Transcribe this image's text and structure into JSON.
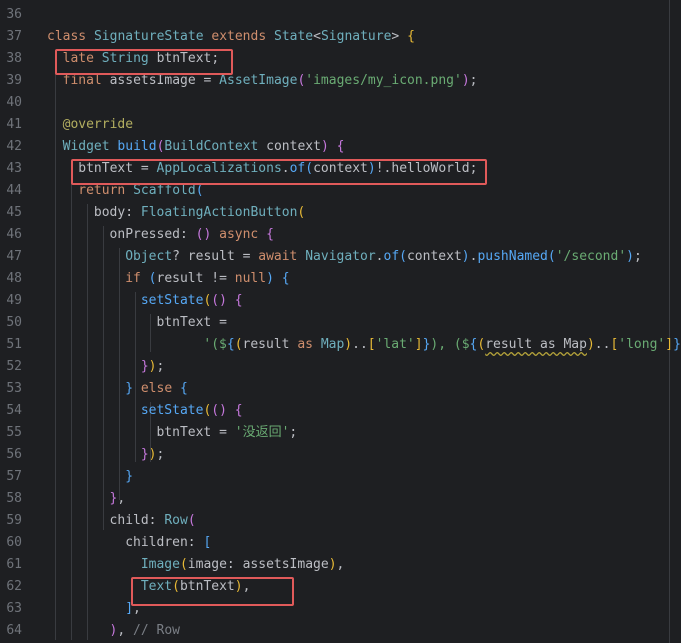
{
  "editor": {
    "lines": [
      {
        "n": "36",
        "segs": []
      },
      {
        "n": "37",
        "segs": [
          [
            "k",
            "class "
          ],
          [
            "cls",
            "SignatureState "
          ],
          [
            "k",
            "extends "
          ],
          [
            "cls",
            "State"
          ],
          [
            "t",
            "<"
          ],
          [
            "cls",
            "Signature"
          ],
          [
            "t",
            "> "
          ],
          [
            "b1",
            "{"
          ]
        ]
      },
      {
        "n": "38",
        "segs": [
          [
            "k",
            "late "
          ],
          [
            "cls",
            "String "
          ],
          [
            "t",
            "btnText;"
          ]
        ]
      },
      {
        "n": "39",
        "segs": [
          [
            "k",
            "final "
          ],
          [
            "t",
            "assetsImage = "
          ],
          [
            "cls",
            "AssetImage"
          ],
          [
            "b2",
            "("
          ],
          [
            "s",
            "'images/my_icon.png'"
          ],
          [
            "b2",
            ")"
          ],
          [
            "t",
            ";"
          ]
        ]
      },
      {
        "n": "40",
        "segs": []
      },
      {
        "n": "41",
        "segs": [
          [
            "a",
            "@override"
          ]
        ]
      },
      {
        "n": "42",
        "segs": [
          [
            "cls",
            "Widget "
          ],
          [
            "f",
            "build"
          ],
          [
            "b2",
            "("
          ],
          [
            "cls",
            "BuildContext "
          ],
          [
            "t",
            "context"
          ],
          [
            "b2",
            ")"
          ],
          [
            "t",
            " "
          ],
          [
            "b2",
            "{"
          ]
        ]
      },
      {
        "n": "43",
        "segs": [
          [
            "t",
            "btnText = "
          ],
          [
            "cls",
            "AppLocalizations"
          ],
          [
            "t",
            "."
          ],
          [
            "f",
            "of"
          ],
          [
            "b3",
            "("
          ],
          [
            "t",
            "context"
          ],
          [
            "b3",
            ")"
          ],
          [
            "t",
            "!.helloWorld;"
          ]
        ]
      },
      {
        "n": "44",
        "segs": [
          [
            "k",
            "return "
          ],
          [
            "cls",
            "Scaffold"
          ],
          [
            "b3",
            "("
          ]
        ]
      },
      {
        "n": "45",
        "segs": [
          [
            "t",
            "body: "
          ],
          [
            "cls",
            "FloatingActionButton"
          ],
          [
            "b1",
            "("
          ]
        ]
      },
      {
        "n": "46",
        "segs": [
          [
            "t",
            "onPressed: "
          ],
          [
            "b2",
            "()"
          ],
          [
            "t",
            " "
          ],
          [
            "k",
            "async "
          ],
          [
            "b2",
            "{"
          ]
        ]
      },
      {
        "n": "47",
        "segs": [
          [
            "cls",
            "Object"
          ],
          [
            "t",
            "? result = "
          ],
          [
            "k",
            "await "
          ],
          [
            "cls",
            "Navigator"
          ],
          [
            "t",
            "."
          ],
          [
            "f",
            "of"
          ],
          [
            "b3",
            "("
          ],
          [
            "t",
            "context"
          ],
          [
            "b3",
            ")"
          ],
          [
            "t",
            "."
          ],
          [
            "f",
            "pushNamed"
          ],
          [
            "b3",
            "("
          ],
          [
            "s",
            "'/second'"
          ],
          [
            "b3",
            ")"
          ],
          [
            "t",
            ";"
          ]
        ]
      },
      {
        "n": "48",
        "segs": [
          [
            "k",
            "if "
          ],
          [
            "b3",
            "("
          ],
          [
            "t",
            "result != "
          ],
          [
            "k",
            "null"
          ],
          [
            "b3",
            ")"
          ],
          [
            "t",
            " "
          ],
          [
            "b3",
            "{"
          ]
        ]
      },
      {
        "n": "49",
        "segs": [
          [
            "f",
            "setState"
          ],
          [
            "b1",
            "("
          ],
          [
            "b2",
            "()"
          ],
          [
            "t",
            " "
          ],
          [
            "b2",
            "{"
          ]
        ]
      },
      {
        "n": "50",
        "segs": [
          [
            "t",
            "btnText ="
          ]
        ]
      },
      {
        "n": "51",
        "segs": [
          [
            "s",
            "'($"
          ],
          [
            "b3",
            "{"
          ],
          [
            "b1",
            "("
          ],
          [
            "t",
            "result "
          ],
          [
            "k",
            "as "
          ],
          [
            "cls",
            "Map"
          ],
          [
            "b1",
            ")"
          ],
          [
            "t",
            ".."
          ],
          [
            "b1",
            "["
          ],
          [
            "s",
            "'lat'"
          ],
          [
            "b1",
            "]"
          ],
          [
            "b3",
            "}"
          ],
          [
            "s",
            "), ($"
          ],
          [
            "b3",
            "{"
          ],
          [
            "b1",
            "("
          ],
          [
            "und",
            "result as Map"
          ],
          [
            "b1",
            ")"
          ],
          [
            "t",
            ".."
          ],
          [
            "b1",
            "["
          ],
          [
            "s",
            "'long'"
          ],
          [
            "b1",
            "]"
          ],
          [
            "b3",
            "}"
          ],
          [
            "s",
            ")'"
          ]
        ]
      },
      {
        "n": "52",
        "segs": [
          [
            "b2",
            "}"
          ],
          [
            "b1",
            ")"
          ],
          [
            "t",
            ";"
          ]
        ]
      },
      {
        "n": "53",
        "segs": [
          [
            "b3",
            "}"
          ],
          [
            "t",
            " "
          ],
          [
            "k",
            "else "
          ],
          [
            "b3",
            "{"
          ]
        ]
      },
      {
        "n": "54",
        "segs": [
          [
            "f",
            "setState"
          ],
          [
            "b1",
            "("
          ],
          [
            "b2",
            "()"
          ],
          [
            "t",
            " "
          ],
          [
            "b2",
            "{"
          ]
        ]
      },
      {
        "n": "55",
        "segs": [
          [
            "t",
            "btnText = "
          ],
          [
            "s",
            "'没返回'"
          ],
          [
            "t",
            ";"
          ]
        ]
      },
      {
        "n": "56",
        "segs": [
          [
            "b2",
            "}"
          ],
          [
            "b1",
            ")"
          ],
          [
            "t",
            ";"
          ]
        ]
      },
      {
        "n": "57",
        "segs": [
          [
            "b3",
            "}"
          ]
        ]
      },
      {
        "n": "58",
        "segs": [
          [
            "b2",
            "}"
          ],
          [
            "t",
            ","
          ]
        ]
      },
      {
        "n": "59",
        "segs": [
          [
            "t",
            "child: "
          ],
          [
            "cls",
            "Row"
          ],
          [
            "b2",
            "("
          ]
        ]
      },
      {
        "n": "60",
        "segs": [
          [
            "t",
            "children: "
          ],
          [
            "b3",
            "["
          ]
        ]
      },
      {
        "n": "61",
        "segs": [
          [
            "cls",
            "Image"
          ],
          [
            "b1",
            "("
          ],
          [
            "t",
            "image: assetsImage"
          ],
          [
            "b1",
            ")"
          ],
          [
            "t",
            ","
          ]
        ]
      },
      {
        "n": "62",
        "segs": [
          [
            "cls",
            "Text"
          ],
          [
            "b1",
            "("
          ],
          [
            "t",
            "btnText"
          ],
          [
            "b1",
            ")"
          ],
          [
            "t",
            ","
          ]
        ]
      },
      {
        "n": "63",
        "segs": [
          [
            "b3",
            "]"
          ],
          [
            "t",
            ","
          ]
        ]
      },
      {
        "n": "64",
        "segs": [
          [
            "b2",
            ")"
          ],
          [
            "t",
            ", "
          ],
          [
            "m",
            "// Row"
          ]
        ]
      }
    ]
  }
}
